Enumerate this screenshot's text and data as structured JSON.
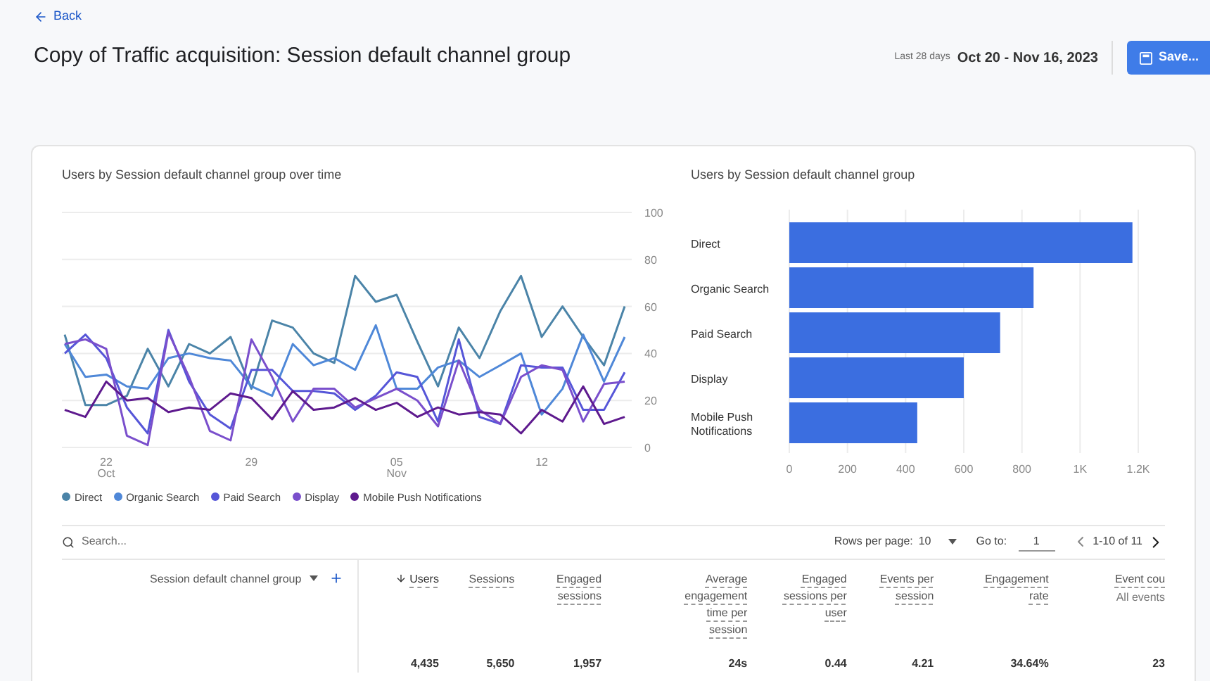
{
  "back": {
    "label": "Back"
  },
  "title": "Copy of Traffic acquisition: Session default channel group",
  "date_range": {
    "preset": "Last 28 days",
    "range": "Oct 20 - Nov 16, 2023"
  },
  "save_button": {
    "label": "Save..."
  },
  "line_chart": {
    "title": "Users by Session default channel group over time",
    "x_axis_labels": [
      "22 Oct",
      "29",
      "05 Nov",
      "12"
    ],
    "chart_data": {
      "type": "line",
      "ylim": [
        0,
        100
      ],
      "yticks": [
        0,
        20,
        40,
        60,
        80,
        100
      ],
      "grid": true,
      "series": [
        {
          "name": "Direct",
          "color": "#4b84a8",
          "values": [
            48,
            18,
            18,
            22,
            42,
            26,
            44,
            40,
            47,
            25,
            54,
            51,
            40,
            36,
            73,
            62,
            65,
            45,
            26,
            51,
            38,
            58,
            73,
            47,
            60,
            47,
            35,
            60
          ]
        },
        {
          "name": "Organic Search",
          "color": "#4f88d8",
          "values": [
            44,
            30,
            31,
            26,
            25,
            38,
            40,
            38,
            37,
            26,
            22,
            44,
            35,
            38,
            33,
            52,
            25,
            25,
            34,
            37,
            30,
            35,
            40,
            14,
            25,
            48,
            28,
            47
          ]
        },
        {
          "name": "Paid Search",
          "color": "#5656d8",
          "values": [
            40,
            48,
            38,
            17,
            6,
            50,
            28,
            14,
            8,
            33,
            33,
            24,
            24,
            23,
            16,
            22,
            32,
            30,
            11,
            46,
            13,
            10,
            35,
            34,
            34,
            16,
            16,
            32
          ]
        },
        {
          "name": "Display",
          "color": "#7a4fcc",
          "values": [
            44,
            46,
            42,
            5,
            1,
            49,
            30,
            7,
            3,
            46,
            30,
            11,
            25,
            25,
            17,
            21,
            25,
            20,
            9,
            37,
            16,
            10,
            30,
            35,
            33,
            11,
            27,
            28
          ]
        },
        {
          "name": "Mobile Push Notifications",
          "color": "#5e1a8e",
          "values": [
            16,
            13,
            28,
            20,
            21,
            15,
            17,
            16,
            23,
            21,
            12,
            24,
            16,
            17,
            21,
            16,
            19,
            13,
            17,
            14,
            15,
            14,
            6,
            16,
            11,
            26,
            10,
            13
          ]
        }
      ]
    }
  },
  "bar_chart": {
    "title": "Users by Session default channel group",
    "chart_data": {
      "type": "bar",
      "orientation": "horizontal",
      "categories": [
        "Direct",
        "Organic Search",
        "Paid Search",
        "Display",
        "Mobile Push Notifications"
      ],
      "values": [
        1180,
        840,
        725,
        600,
        440
      ],
      "xlim": [
        0,
        1200
      ],
      "grid": true,
      "xticks": [
        0,
        200,
        400,
        600,
        800,
        {
          "value": 1000,
          "label": "1K"
        },
        {
          "value": 1200,
          "label": "1.2K"
        }
      ]
    }
  },
  "table_toolbar": {
    "search_placeholder": "Search...",
    "rows_per_page_label": "Rows per page:",
    "rows_per_page": "10",
    "goto_label": "Go to:",
    "goto_value": "1",
    "page_range": "1-10 of 11"
  },
  "table": {
    "dimension_column": "Session default channel group",
    "columns": [
      {
        "label": "Users",
        "sorted": true
      },
      {
        "label": "Sessions",
        "sorted": false
      },
      {
        "label": "Engaged sessions",
        "sorted": false
      },
      {
        "label": "Average engagement time per session",
        "sorted": false
      },
      {
        "label": "Engaged sessions per user",
        "sorted": false
      },
      {
        "label": "Events per session",
        "sorted": false
      },
      {
        "label": "Engagement rate",
        "sorted": false
      },
      {
        "label": "Event cou",
        "sublabel": "All events",
        "sorted": false
      }
    ],
    "totals": [
      "4,435",
      "5,650",
      "1,957",
      "24s",
      "0.44",
      "4.21",
      "34.64%",
      "23"
    ]
  }
}
